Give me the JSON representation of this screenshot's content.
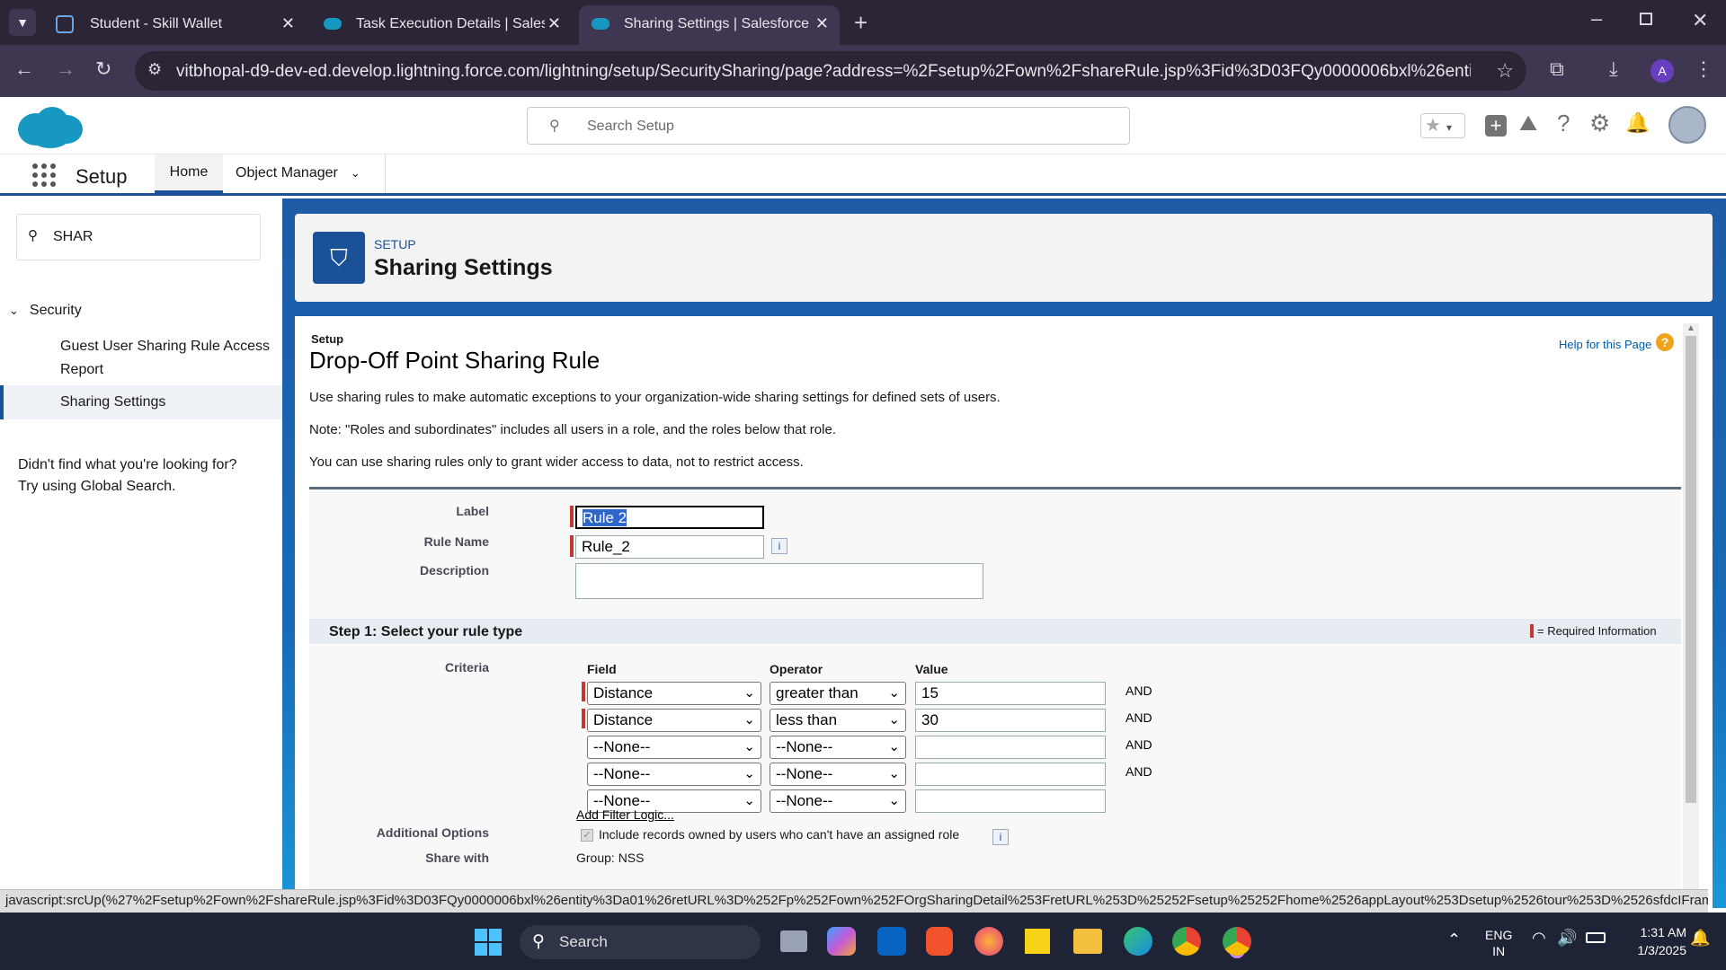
{
  "browser": {
    "tabs": [
      {
        "title": "Student - Skill Wallet",
        "active": false
      },
      {
        "title": "Task Execution Details | Salesfor",
        "active": false
      },
      {
        "title": "Sharing Settings | Salesforce",
        "active": true
      }
    ],
    "url": "vitbhopal-d9-dev-ed.develop.lightning.force.com/lightning/setup/SecuritySharing/page?address=%2Fsetup%2Fown%2FshareRule.jsp%3Fid%3D03FQy0000006bxl%26entity%3Da01%26r...",
    "profile_initial": "A"
  },
  "sf": {
    "search_placeholder": "Search Setup",
    "app_name": "Setup",
    "nav_home": "Home",
    "nav_object_manager": "Object Manager"
  },
  "sidebar": {
    "quickfind_value": "SHAR",
    "section": "Security",
    "items": [
      "Guest User Sharing Rule Access Report",
      "Sharing Settings"
    ],
    "notfound_1": "Didn't find what you're looking for?",
    "notfound_2": "Try using Global Search."
  },
  "header": {
    "eyebrow": "SETUP",
    "title": "Sharing Settings"
  },
  "page": {
    "setup_small": "Setup",
    "title": "Drop-Off Point Sharing Rule",
    "help": "Help for this Page",
    "p1": "Use sharing rules to make automatic exceptions to your organization-wide sharing settings for defined sets of users.",
    "p2": "Note: \"Roles and subordinates\" includes all users in a role, and the roles below that role.",
    "p3": "You can use sharing rules only to grant wider access to data, not to restrict access.",
    "label_lbl": "Label",
    "label_val": "Rule 2",
    "rulename_lbl": "Rule Name",
    "rulename_val": "Rule_2",
    "desc_lbl": "Description",
    "step1": "Step 1: Select your rule type",
    "required_info": "= Required Information",
    "criteria_lbl": "Criteria",
    "col_field": "Field",
    "col_operator": "Operator",
    "col_value": "Value",
    "rows": [
      {
        "field": "Distance",
        "op": "greater than",
        "val": "15",
        "and": "AND"
      },
      {
        "field": "Distance",
        "op": "less than",
        "val": "30",
        "and": "AND"
      },
      {
        "field": "--None--",
        "op": "--None--",
        "val": "",
        "and": "AND"
      },
      {
        "field": "--None--",
        "op": "--None--",
        "val": "",
        "and": "AND"
      },
      {
        "field": "--None--",
        "op": "--None--",
        "val": "",
        "and": ""
      }
    ],
    "add_filter": "Add Filter Logic...",
    "addl_lbl": "Additional Options",
    "addl_text": "Include records owned by users who can't have an assigned role",
    "share_lbl": "Share with",
    "share_val": "Group: NSS"
  },
  "status_url": "javascript:srcUp(%27%2Fsetup%2Fown%2FshareRule.jsp%3Fid%3D03FQy0000006bxl%26entity%3Da01%26retURL%3D%252Fp%252Fown%252FOrgSharingDetail%253FretURL%253D%25252Fsetup%25252Fhome%2526appLayout%253Dsetup%2526tour%253D%2526sfdcIFrameOrig...",
  "taskbar": {
    "search": "Search",
    "lang1": "ENG",
    "lang2": "IN",
    "time": "1:31 AM",
    "date": "1/3/2025"
  }
}
